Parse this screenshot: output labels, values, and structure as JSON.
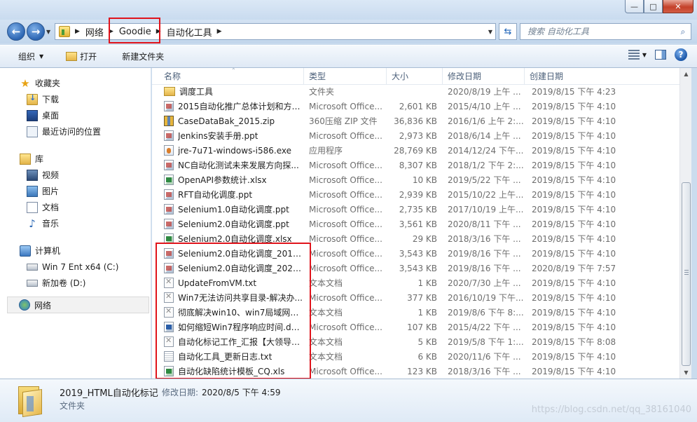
{
  "window": {
    "title_text": "",
    "buttons": {
      "minimize": "—",
      "maximize": "□",
      "close": "✕"
    }
  },
  "address": {
    "crumbs": [
      "网络",
      "Goodie",
      "自动化工具"
    ]
  },
  "search": {
    "placeholder": "搜索 自动化工具"
  },
  "toolbar": {
    "organize": "组织",
    "open": "打开",
    "new_folder": "新建文件夹"
  },
  "nav": {
    "favorites": {
      "label": "收藏夹",
      "items": [
        "下载",
        "桌面",
        "最近访问的位置"
      ]
    },
    "libraries": {
      "label": "库",
      "items": [
        "视频",
        "图片",
        "文档",
        "音乐"
      ]
    },
    "computer": {
      "label": "计算机",
      "items": [
        "Win 7 Ent x64 (C:)",
        "新加卷 (D:)"
      ]
    },
    "network": {
      "label": "网络"
    }
  },
  "columns": {
    "name": "名称",
    "type": "类型",
    "size": "大小",
    "modified": "修改日期",
    "created": "创建日期"
  },
  "files": [
    {
      "name": "调度工具",
      "type": "文件夹",
      "size": "",
      "modified": "2020/8/19 上午 ...",
      "created": "2019/8/15 下午 4:23",
      "icon": "folder"
    },
    {
      "name": "2015自动化推广总体计划和方案...",
      "type": "Microsoft Office...",
      "size": "2,601 KB",
      "modified": "2015/4/10 上午 ...",
      "created": "2019/8/15 下午 4:10",
      "icon": "office"
    },
    {
      "name": "CaseDataBak_2015.zip",
      "type": "360压缩 ZIP 文件",
      "size": "36,836 KB",
      "modified": "2016/1/6 上午 2:...",
      "created": "2019/8/15 下午 4:10",
      "icon": "zip"
    },
    {
      "name": "Jenkins安装手册.ppt",
      "type": "Microsoft Office...",
      "size": "2,973 KB",
      "modified": "2018/6/14 上午 ...",
      "created": "2019/8/15 下午 4:10",
      "icon": "office"
    },
    {
      "name": "jre-7u71-windows-i586.exe",
      "type": "应用程序",
      "size": "28,769 KB",
      "modified": "2014/12/24 下午...",
      "created": "2019/8/15 下午 4:10",
      "icon": "exe"
    },
    {
      "name": "NC自动化测试未来发展方向探...",
      "type": "Microsoft Office...",
      "size": "8,307 KB",
      "modified": "2018/1/2 下午 2:...",
      "created": "2019/8/15 下午 4:10",
      "icon": "office"
    },
    {
      "name": "OpenAPI参数统计.xlsx",
      "type": "Microsoft Office...",
      "size": "10 KB",
      "modified": "2019/5/22 下午 ...",
      "created": "2019/8/15 下午 4:10",
      "icon": "xls"
    },
    {
      "name": "RFT自动化调度.ppt",
      "type": "Microsoft Office...",
      "size": "2,939 KB",
      "modified": "2015/10/22 上午...",
      "created": "2019/8/15 下午 4:10",
      "icon": "office"
    },
    {
      "name": "Selenium1.0自动化调度.ppt",
      "type": "Microsoft Office...",
      "size": "2,735 KB",
      "modified": "2017/10/19 上午...",
      "created": "2019/8/15 下午 4:10",
      "icon": "office"
    },
    {
      "name": "Selenium2.0自动化调度.ppt",
      "type": "Microsoft Office...",
      "size": "3,561 KB",
      "modified": "2020/8/11 下午 ...",
      "created": "2019/8/15 下午 4:10",
      "icon": "office"
    },
    {
      "name": "Selenium2.0自动化调度.xlsx",
      "type": "Microsoft Office...",
      "size": "29 KB",
      "modified": "2018/3/16 下午 ...",
      "created": "2019/8/15 下午 4:10",
      "icon": "xls"
    },
    {
      "name": "Selenium2.0自动化调度_2019.p...",
      "type": "Microsoft Office...",
      "size": "3,543 KB",
      "modified": "2019/8/16 下午 ...",
      "created": "2019/8/15 下午 4:10",
      "icon": "office"
    },
    {
      "name": "Selenium2.0自动化调度_2020.p...",
      "type": "Microsoft Office...",
      "size": "3,543 KB",
      "modified": "2019/8/16 下午 ...",
      "created": "2020/8/19 下午 7:57",
      "icon": "office"
    },
    {
      "name": "UpdateFromVM.txt",
      "type": "文本文档",
      "size": "1 KB",
      "modified": "2020/7/30 上午 ...",
      "created": "2019/8/15 下午 4:10",
      "icon": "unk"
    },
    {
      "name": "Win7无法访问共享目录-解决办...",
      "type": "Microsoft Office...",
      "size": "377 KB",
      "modified": "2016/10/19 下午...",
      "created": "2019/8/15 下午 4:10",
      "icon": "unk"
    },
    {
      "name": "彻底解决win10、win7局域网共...",
      "type": "文本文档",
      "size": "1 KB",
      "modified": "2019/8/6 下午 8:...",
      "created": "2019/8/15 下午 4:10",
      "icon": "unk"
    },
    {
      "name": "如何缩短Win7程序响应时间.docx",
      "type": "Microsoft Office...",
      "size": "107 KB",
      "modified": "2015/4/22 下午 ...",
      "created": "2019/8/15 下午 4:10",
      "icon": "docx"
    },
    {
      "name": "自动化标记工作_汇报【大领导】...",
      "type": "文本文档",
      "size": "5 KB",
      "modified": "2019/5/8 下午 1:...",
      "created": "2019/8/15 下午 8:08",
      "icon": "unk"
    },
    {
      "name": "自动化工具_更新日志.txt",
      "type": "文本文档",
      "size": "6 KB",
      "modified": "2020/11/6 下午 ...",
      "created": "2019/8/15 下午 4:10",
      "icon": "txt"
    },
    {
      "name": "自动化缺陷统计模板_CQ.xls",
      "type": "Microsoft Office...",
      "size": "123 KB",
      "modified": "2018/3/16 下午 ...",
      "created": "2019/8/15 下午 4:10",
      "icon": "xls"
    }
  ],
  "details": {
    "name": "2019_HTML自动化标记",
    "modified_label": "修改日期:",
    "modified_value": "2020/8/5 下午 4:59",
    "type": "文件夹"
  },
  "watermark": "https://blog.csdn.net/qq_38161040",
  "colors": {
    "highlight_box": "#e0141c",
    "accent": "#2d66b3"
  }
}
